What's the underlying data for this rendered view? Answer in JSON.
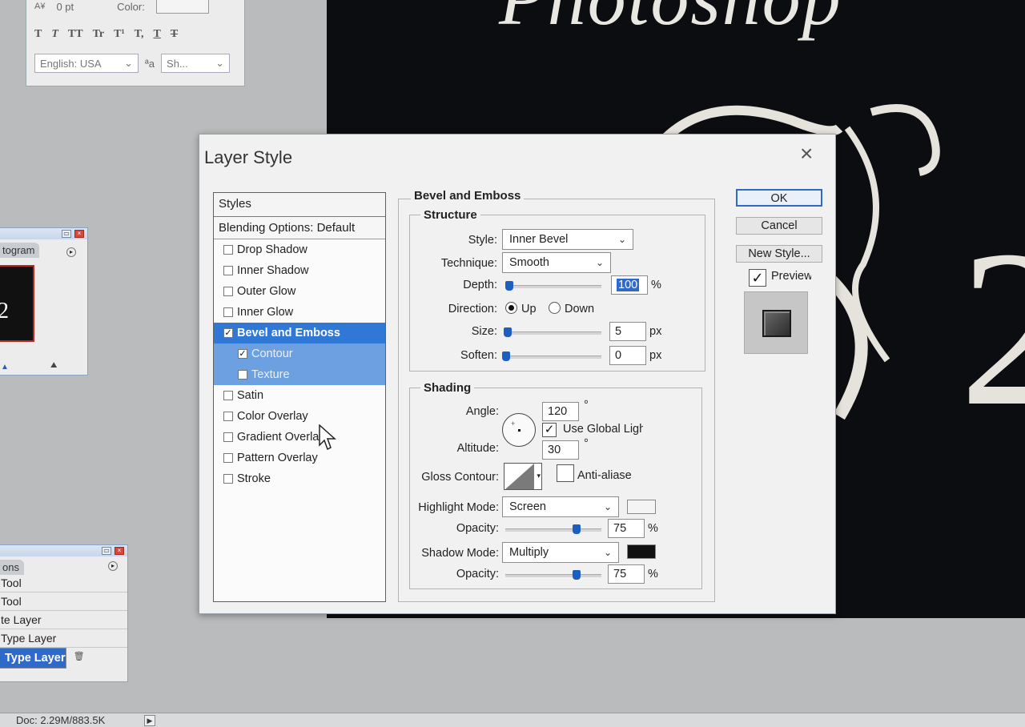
{
  "canvas": {
    "title_text": "Photoshop",
    "big_glyph": "2"
  },
  "char_panel": {
    "tracking_value": "0 pt",
    "color_label": "Color:",
    "format_buttons": [
      "T",
      "T",
      "TT",
      "Tr",
      "T¹",
      "T,",
      "T",
      "T"
    ],
    "language": "English: USA",
    "aa_label": "ªa",
    "aa_value": "Sh..."
  },
  "histogram": {
    "tab_label": "togram",
    "image_text": "2"
  },
  "actions": {
    "tab_label": "ons",
    "items": [
      "Tool",
      "Tool",
      "te Layer",
      "Type Layer",
      "Type Layer"
    ]
  },
  "status": {
    "doc": "Doc: 2.29M/883.5K"
  },
  "dialog": {
    "title": "Layer Style",
    "styles_header": "Styles",
    "blending_options": "Blending Options: Default",
    "style_items": [
      {
        "label": "Drop Shadow",
        "checked": false
      },
      {
        "label": "Inner Shadow",
        "checked": false
      },
      {
        "label": "Outer Glow",
        "checked": false
      },
      {
        "label": "Inner Glow",
        "checked": false
      },
      {
        "label": "Bevel and Emboss",
        "checked": true
      },
      {
        "label": "Contour",
        "checked": true
      },
      {
        "label": "Texture",
        "checked": false
      },
      {
        "label": "Satin",
        "checked": false
      },
      {
        "label": "Color Overlay",
        "checked": false
      },
      {
        "label": "Gradient Overla",
        "checked": false
      },
      {
        "label": "Pattern Overlay",
        "checked": false
      },
      {
        "label": "Stroke",
        "checked": false
      }
    ],
    "bevel_title": "Bevel and Emboss",
    "structure": {
      "title": "Structure",
      "style_label": "Style:",
      "style_value": "Inner Bevel",
      "technique_label": "Technique:",
      "technique_value": "Smooth",
      "depth_label": "Depth:",
      "depth_value": "100",
      "depth_unit": "%",
      "direction_label": "Direction:",
      "dir_up": "Up",
      "dir_down": "Down",
      "size_label": "Size:",
      "size_value": "5",
      "size_unit": "px",
      "soften_label": "Soften:",
      "soften_value": "0",
      "soften_unit": "px"
    },
    "shading": {
      "title": "Shading",
      "angle_label": "Angle:",
      "angle_value": "120",
      "degree": "°",
      "global_light": "Use Global Light",
      "altitude_label": "Altitude:",
      "altitude_value": "30",
      "gloss_label": "Gloss Contour:",
      "anti_aliased": "Anti-aliased",
      "highlight_label": "Highlight Mode:",
      "highlight_value": "Screen",
      "highlight_color": "#f4f4f4",
      "hl_opacity_label": "Opacity:",
      "hl_opacity_value": "75",
      "shadow_label": "Shadow Mode:",
      "shadow_value": "Multiply",
      "shadow_color": "#111111",
      "sh_opacity_label": "Opacity:",
      "sh_opacity_value": "75",
      "percent": "%"
    },
    "buttons": {
      "ok": "OK",
      "cancel": "Cancel",
      "new_style": "New Style...",
      "preview": "Preview"
    }
  }
}
